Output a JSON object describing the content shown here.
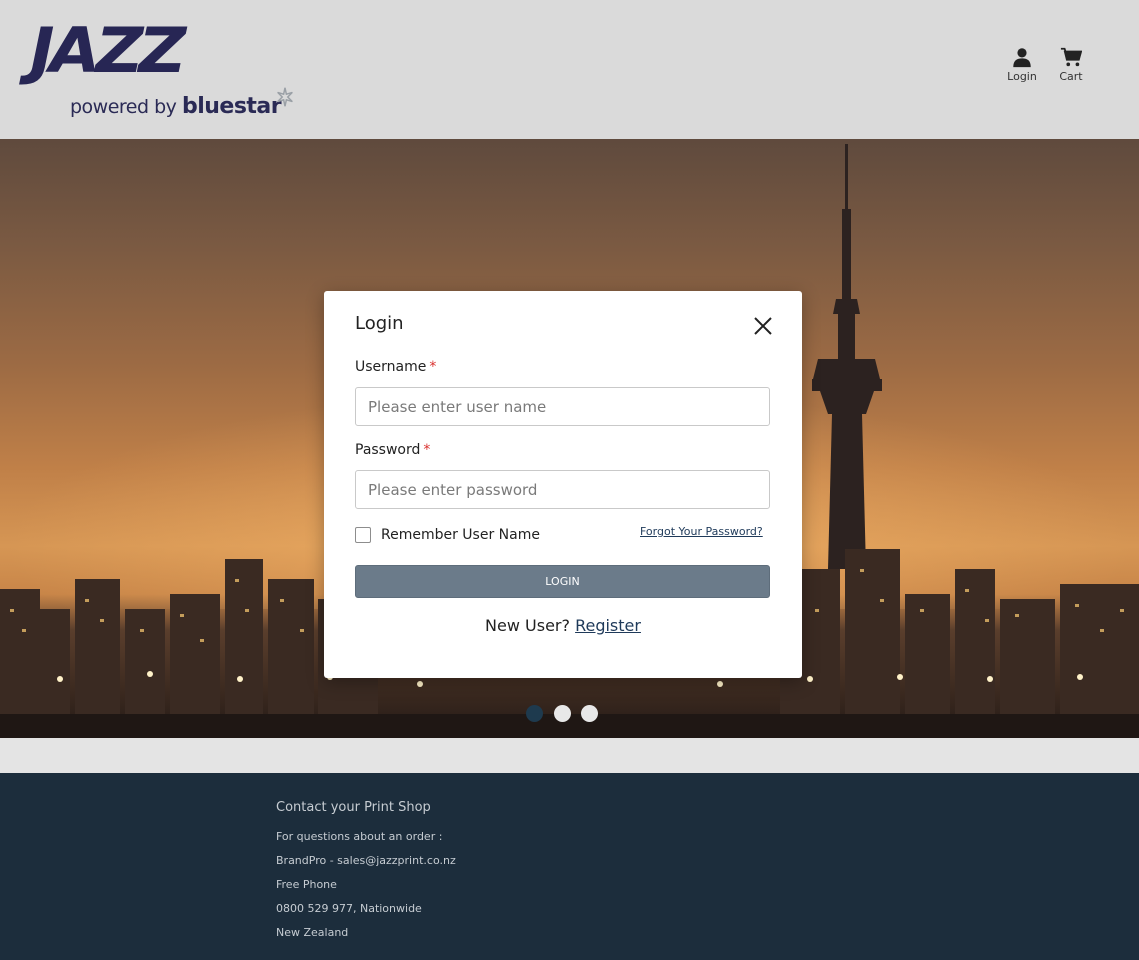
{
  "header": {
    "logo_text": "JAZZ",
    "logo_powered_by": "powered by",
    "logo_brand": "bluestar",
    "login_label": "Login",
    "cart_label": "Cart"
  },
  "hero": {
    "slide_count": 3,
    "active_slide": 1
  },
  "modal": {
    "title": "Login",
    "username_label": "Username",
    "username_placeholder": "Please enter user name",
    "username_value": "",
    "password_label": "Password",
    "password_placeholder": "Please enter password",
    "password_value": "",
    "required_marker": "*",
    "remember_label": "Remember User Name",
    "remember_checked": false,
    "forgot_label": "Forgot Your Password?",
    "login_button": "LOGIN",
    "new_user_text": "New User?",
    "register_label": "Register"
  },
  "footer": {
    "title": "Contact your Print Shop",
    "lines": [
      "For questions about an order :",
      "BrandPro - sales@jazzprint.co.nz",
      "Free Phone",
      "0800 529 977, Nationwide",
      "New Zealand"
    ]
  },
  "colors": {
    "brand_navy": "#272654",
    "footer_bg": "#1c2d3c",
    "button_grey": "#6b7b8a",
    "required_red": "#d9302d",
    "active_dot": "#1e3a4e"
  },
  "icons": {
    "login": "user-icon",
    "cart": "cart-icon",
    "close": "close-icon",
    "logo_star": "star-icon"
  }
}
